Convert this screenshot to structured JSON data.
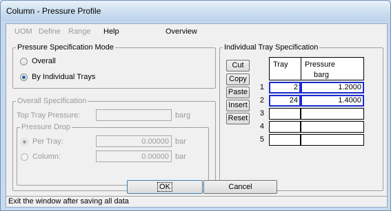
{
  "window": {
    "title": "Column - Pressure Profile"
  },
  "menu": {
    "uom": "UOM",
    "define": "Define",
    "range": "Range",
    "help": "Help",
    "overview": "Overview"
  },
  "pressure_mode": {
    "legend": "Pressure Specification Mode",
    "overall": "Overall",
    "individual": "By Individual Trays",
    "selected": "By Individual Trays"
  },
  "overall_spec": {
    "legend": "Overall Specification",
    "top_tray_label": "Top Tray Pressure:",
    "top_tray_value": "",
    "top_tray_unit": "barg",
    "drop_legend": "Pressure Drop",
    "per_tray_label": "Per Tray:",
    "per_tray_value": "0.00000",
    "per_tray_unit": "bar",
    "column_label": "Column:",
    "column_value": "0.00000",
    "column_unit": "bar"
  },
  "tray_spec": {
    "legend": "Individual Tray Specification",
    "buttons": {
      "cut": "Cut",
      "copy": "Copy",
      "paste": "Paste",
      "insert": "Insert",
      "reset": "Reset"
    },
    "headers": {
      "tray": "Tray",
      "pressure": "Pressure",
      "pressure_unit": "barg"
    },
    "rows": [
      {
        "num": "1",
        "tray": "2",
        "pressure": "1.2000"
      },
      {
        "num": "2",
        "tray": "24",
        "pressure": "1.4000"
      },
      {
        "num": "3",
        "tray": "",
        "pressure": ""
      },
      {
        "num": "4",
        "tray": "",
        "pressure": ""
      },
      {
        "num": "5",
        "tray": "",
        "pressure": ""
      }
    ]
  },
  "actions": {
    "ok": "OK",
    "cancel": "Cancel"
  },
  "status": {
    "text": "Exit the window after saving all data"
  }
}
